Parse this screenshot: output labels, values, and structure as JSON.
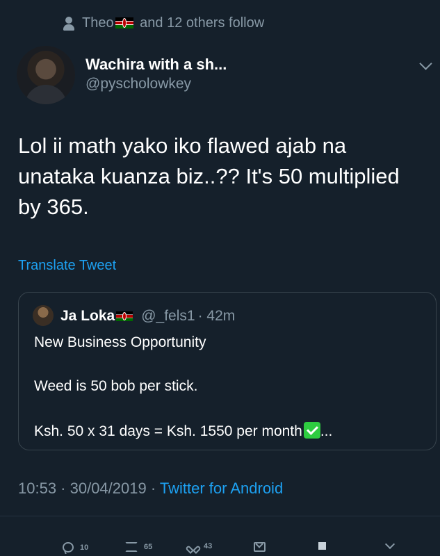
{
  "social_context": {
    "name": "Theo",
    "rest": "and 12 others follow"
  },
  "author": {
    "display_name": "Wachira with a sh...",
    "handle": "@pyscholowkey"
  },
  "tweet": {
    "text": "Lol ii math yako iko flawed ajab na unataka kuanza biz..?? It's 50 multiplied by 365.",
    "translate_label": "Translate Tweet"
  },
  "quoted": {
    "name": "Ja Loka",
    "handle": "@_fels1",
    "time": "· 42m",
    "line1": "New Business Opportunity",
    "line2": "Weed is 50 bob per stick.",
    "line3": "Ksh. 50 x 31 days = Ksh. 1550 per month",
    "line3_suffix": "..."
  },
  "timestamp": {
    "time_date": "10:53 · 30/04/2019 · ",
    "source": "Twitter for Android"
  },
  "actions": {
    "replies": "10",
    "retweets": "65",
    "likes": "43"
  },
  "colors": {
    "background": "#15202b",
    "secondary": "#8899a6",
    "link": "#1da1f2",
    "border": "#38444d"
  },
  "icons": [
    "person-icon",
    "kenya-flag-icon",
    "chevron-down-icon",
    "check-mark-icon",
    "reply-icon",
    "retweet-icon",
    "like-icon",
    "message-icon",
    "square-icon"
  ]
}
